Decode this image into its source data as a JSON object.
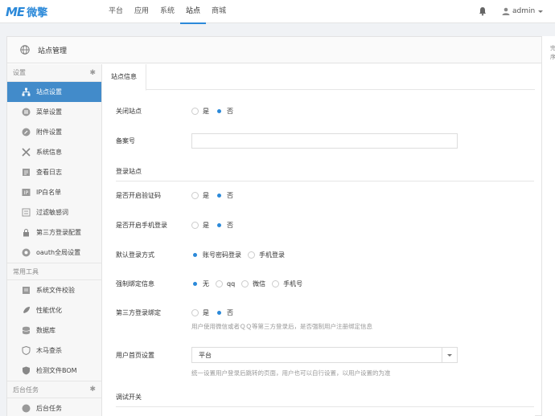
{
  "brand": {
    "logo_mark": "ME",
    "logo_text": "微擎"
  },
  "topnav": {
    "items": [
      "平台",
      "应用",
      "系统",
      "站点",
      "商城"
    ],
    "active": "站点"
  },
  "user": {
    "name": "admin"
  },
  "panel": {
    "title": "站点管理"
  },
  "sidebar": {
    "groups": [
      {
        "title": "设置",
        "items": [
          "站点设置",
          "菜单设置",
          "附件设置",
          "系统信息",
          "查看日志",
          "IP白名单",
          "过滤敏感词",
          "第三方登录配置",
          "oauth全局设置"
        ]
      },
      {
        "title": "常用工具",
        "items": [
          "系统文件校验",
          "性能优化",
          "数据库",
          "木马查杀",
          "检测文件BOM"
        ]
      },
      {
        "title": "后台任务",
        "items": [
          "后台任务"
        ]
      }
    ],
    "active": "站点设置"
  },
  "tab": {
    "label": "站点信息"
  },
  "form": {
    "close_site": {
      "label": "关闭站点",
      "options": [
        "是",
        "否"
      ],
      "selected": "否"
    },
    "icp": {
      "label": "备案号",
      "value": ""
    },
    "section_login": "登录站点",
    "captcha": {
      "label": "是否开启验证码",
      "options": [
        "是",
        "否"
      ],
      "selected": "否"
    },
    "mobile_login": {
      "label": "是否开启手机登录",
      "options": [
        "是",
        "否"
      ],
      "selected": "否"
    },
    "default_login": {
      "label": "默认登录方式",
      "options": [
        "账号密码登录",
        "手机登录"
      ],
      "selected": "账号密码登录"
    },
    "force_bind": {
      "label": "强制绑定信息",
      "options": [
        "无",
        "qq",
        "微信",
        "手机号"
      ],
      "selected": "无"
    },
    "third_bind": {
      "label": "第三方登录绑定",
      "options": [
        "是",
        "否"
      ],
      "selected": "否",
      "help": "用户使用微信或者ＱＱ等第三方登录后，是否强制用户注册绑定信息"
    },
    "home_page": {
      "label": "用户首页设置",
      "value": "平台",
      "help": "统一设置用户登录后跳转的页面，用户也可以自行设置，以用户设置的为准"
    },
    "section_debug": "调试开关"
  },
  "right_strip": [
    "完",
    "序"
  ],
  "colors": {
    "accent": "#2b89d9",
    "active_item": "#428bca"
  }
}
